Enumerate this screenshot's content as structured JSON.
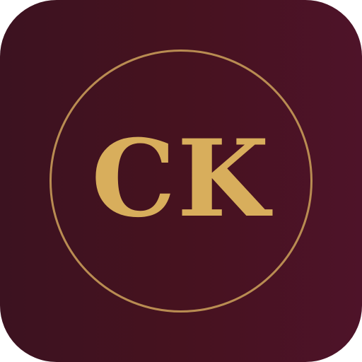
{
  "icon": {
    "monogram_text": "CK",
    "background_colors": [
      "#3c1220",
      "#4e1329"
    ],
    "ring_color": "#b98c52",
    "text_color": "#d8ae5c"
  }
}
